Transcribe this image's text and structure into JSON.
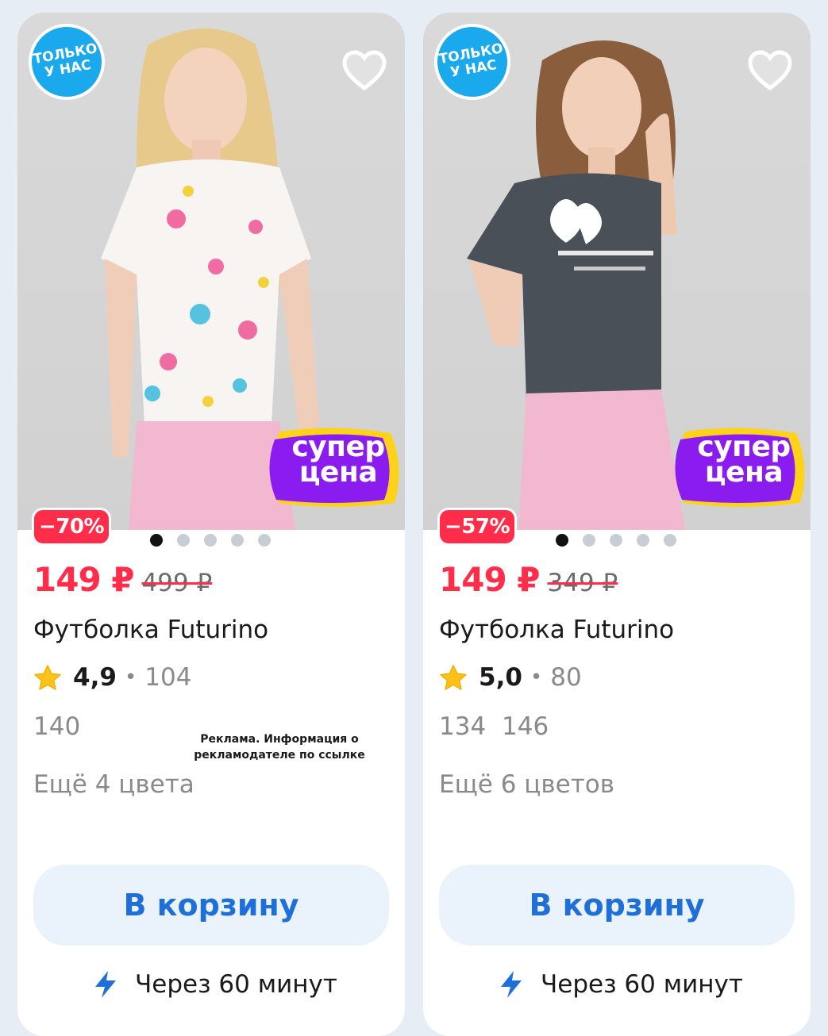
{
  "products": [
    {
      "badge_top": "ТОЛЬКО",
      "badge_bottom": "У НАС",
      "super_line1": "супер",
      "super_line2": "цена",
      "discount": "−70%",
      "price_new": "149 ₽",
      "price_old": "499 ₽",
      "title": "Футболка Futurino",
      "rating": "4,9",
      "reviews": "104",
      "sizes": "140",
      "colors_more": "Ещё 4 цвета",
      "ad_note": "Реклама. Информация о рекламодателе по ссылке",
      "cart_label": "В корзину",
      "delivery": "Через 60 минут"
    },
    {
      "badge_top": "ТОЛЬКО",
      "badge_bottom": "У НАС",
      "super_line1": "супер",
      "super_line2": "цена",
      "discount": "−57%",
      "price_new": "149 ₽",
      "price_old": "349 ₽",
      "title": "Футболка Futurino",
      "rating": "5,0",
      "reviews": "80",
      "sizes": "134  146",
      "colors_more": "Ещё 6 цветов",
      "cart_label": "В корзину",
      "delivery": "Через 60 минут"
    }
  ],
  "colors": {
    "accent_red": "#ff2d4a",
    "accent_blue": "#1f6fd8",
    "badge_blue": "#1aa9ec",
    "super_purple": "#8a1cf0",
    "super_yellow": "#ffd21a"
  },
  "carousel": {
    "images": 5,
    "active_index": 0
  }
}
